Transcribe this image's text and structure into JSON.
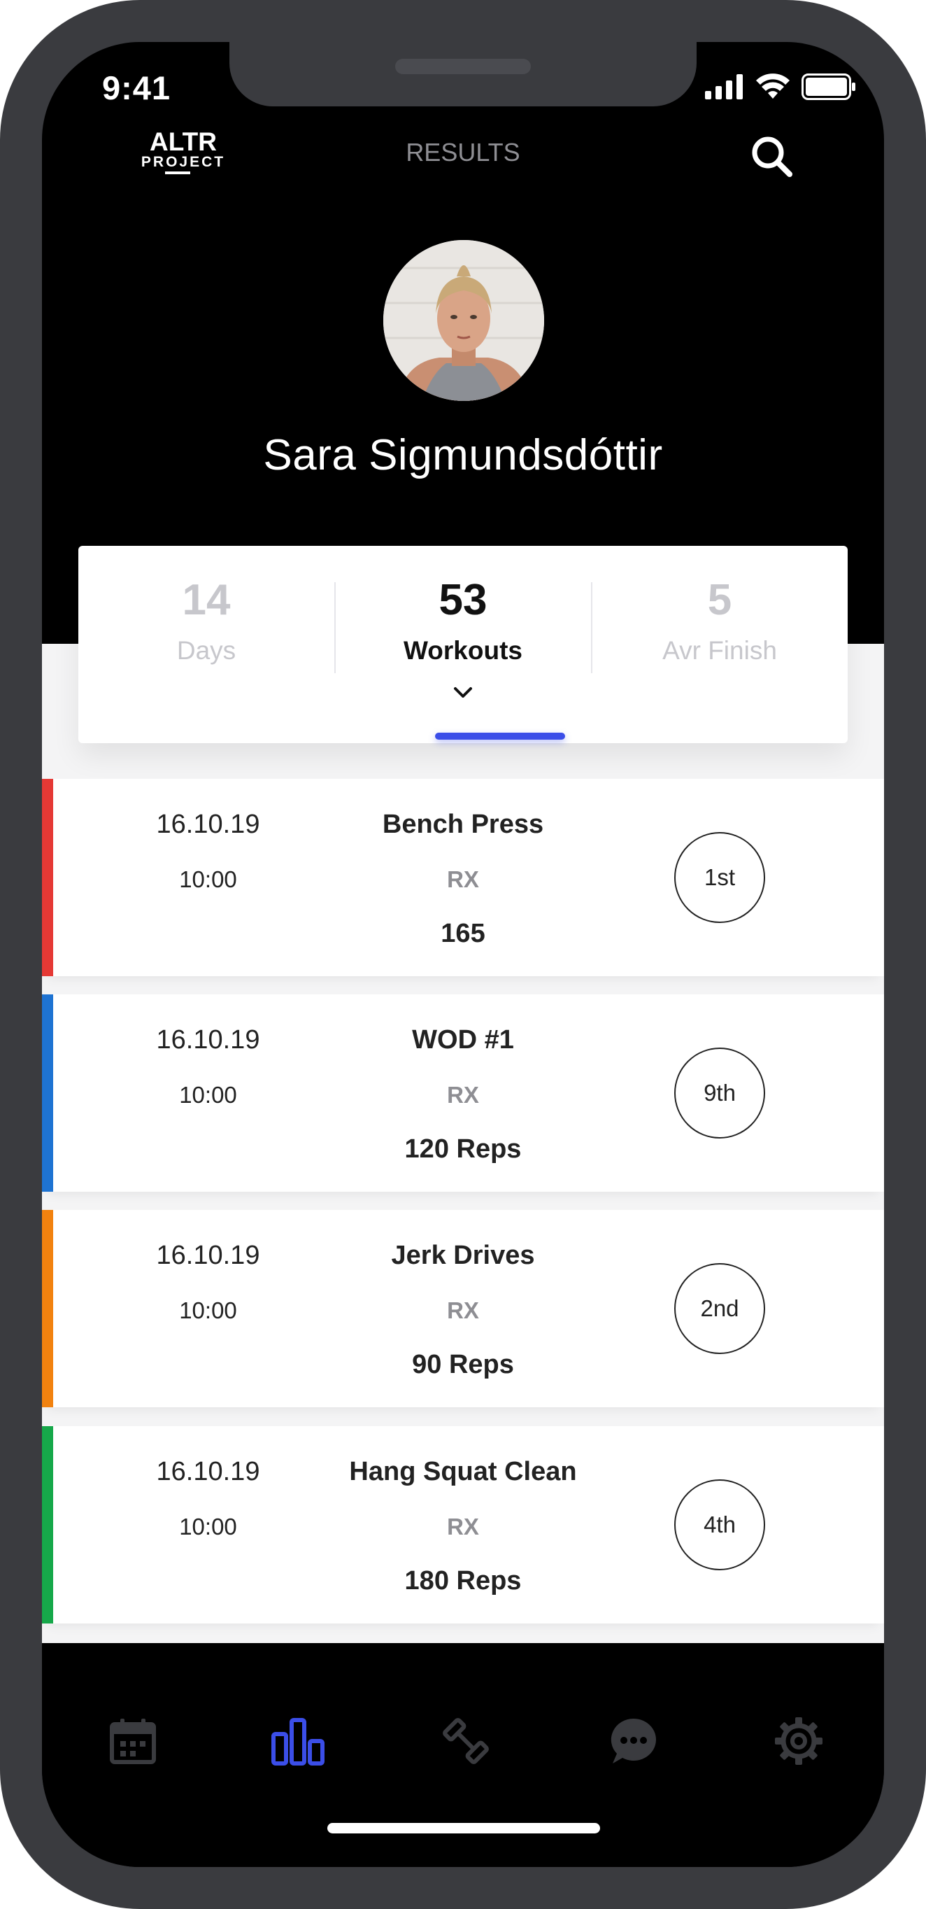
{
  "status_bar": {
    "time": "9:41"
  },
  "header": {
    "logo_top": "ALTR",
    "logo_bottom": "PROJECT",
    "title": "RESULTS"
  },
  "profile": {
    "name": "Sara Sigmundsdóttir"
  },
  "stats": [
    {
      "value": "14",
      "label": "Days",
      "active": false
    },
    {
      "value": "53",
      "label": "Workouts",
      "active": true
    },
    {
      "value": "5",
      "label": "Avr Finish",
      "active": false
    }
  ],
  "results": [
    {
      "date": "16.10.19",
      "time": "10:00",
      "name": "Bench Press",
      "level": "RX",
      "score": "165",
      "rank": "1st",
      "color": "#e53935"
    },
    {
      "date": "16.10.19",
      "time": "10:00",
      "name": "WOD #1",
      "level": "RX",
      "score": "120 Reps",
      "rank": "9th",
      "color": "#1e73d2"
    },
    {
      "date": "16.10.19",
      "time": "10:00",
      "name": "Jerk Drives",
      "level": "RX",
      "score": "90 Reps",
      "rank": "2nd",
      "color": "#f2820f"
    },
    {
      "date": "16.10.19",
      "time": "10:00",
      "name": "Hang Squat Clean",
      "level": "RX",
      "score": "180 Reps",
      "rank": "4th",
      "color": "#16a84a"
    }
  ],
  "tab_bar": {
    "active_tab": "results",
    "tabs": [
      {
        "icon": "calendar-icon"
      },
      {
        "icon": "results-bar-chart-icon"
      },
      {
        "icon": "dumbbell-icon"
      },
      {
        "icon": "chat-bubble-icon"
      },
      {
        "icon": "gear-icon"
      }
    ],
    "active_color": "#3b4ee8",
    "inactive_color": "#3a3b3f"
  }
}
